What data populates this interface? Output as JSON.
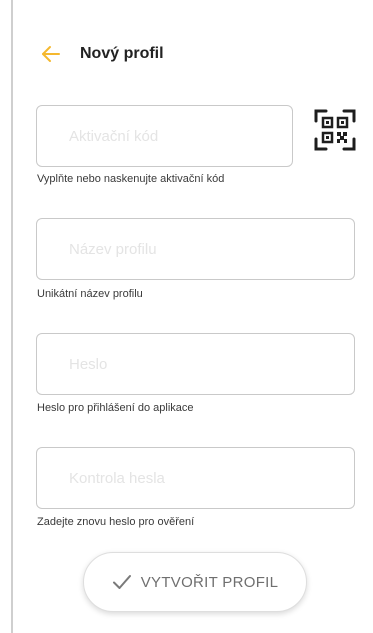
{
  "header": {
    "title": "Nový profil",
    "back_icon": "arrow-left-icon",
    "accent_color": "#f5b82e"
  },
  "form": {
    "activation": {
      "placeholder": "Aktivační kód",
      "value": "",
      "helper": "Vyplňte nebo naskenujte aktivační kód",
      "scan_icon": "qr-code-icon"
    },
    "profile_name": {
      "placeholder": "Název profilu",
      "value": "",
      "helper": "Unikátní název profilu"
    },
    "password": {
      "placeholder": "Heslo",
      "value": "",
      "helper": "Heslo pro přihlášení do aplikace"
    },
    "password_confirm": {
      "placeholder": "Kontrola hesla",
      "value": "",
      "helper": "Zadejte znovu heslo pro ověření"
    }
  },
  "actions": {
    "create_label": "VYTVOŘIT PROFIL",
    "create_icon": "checkmark-icon"
  }
}
